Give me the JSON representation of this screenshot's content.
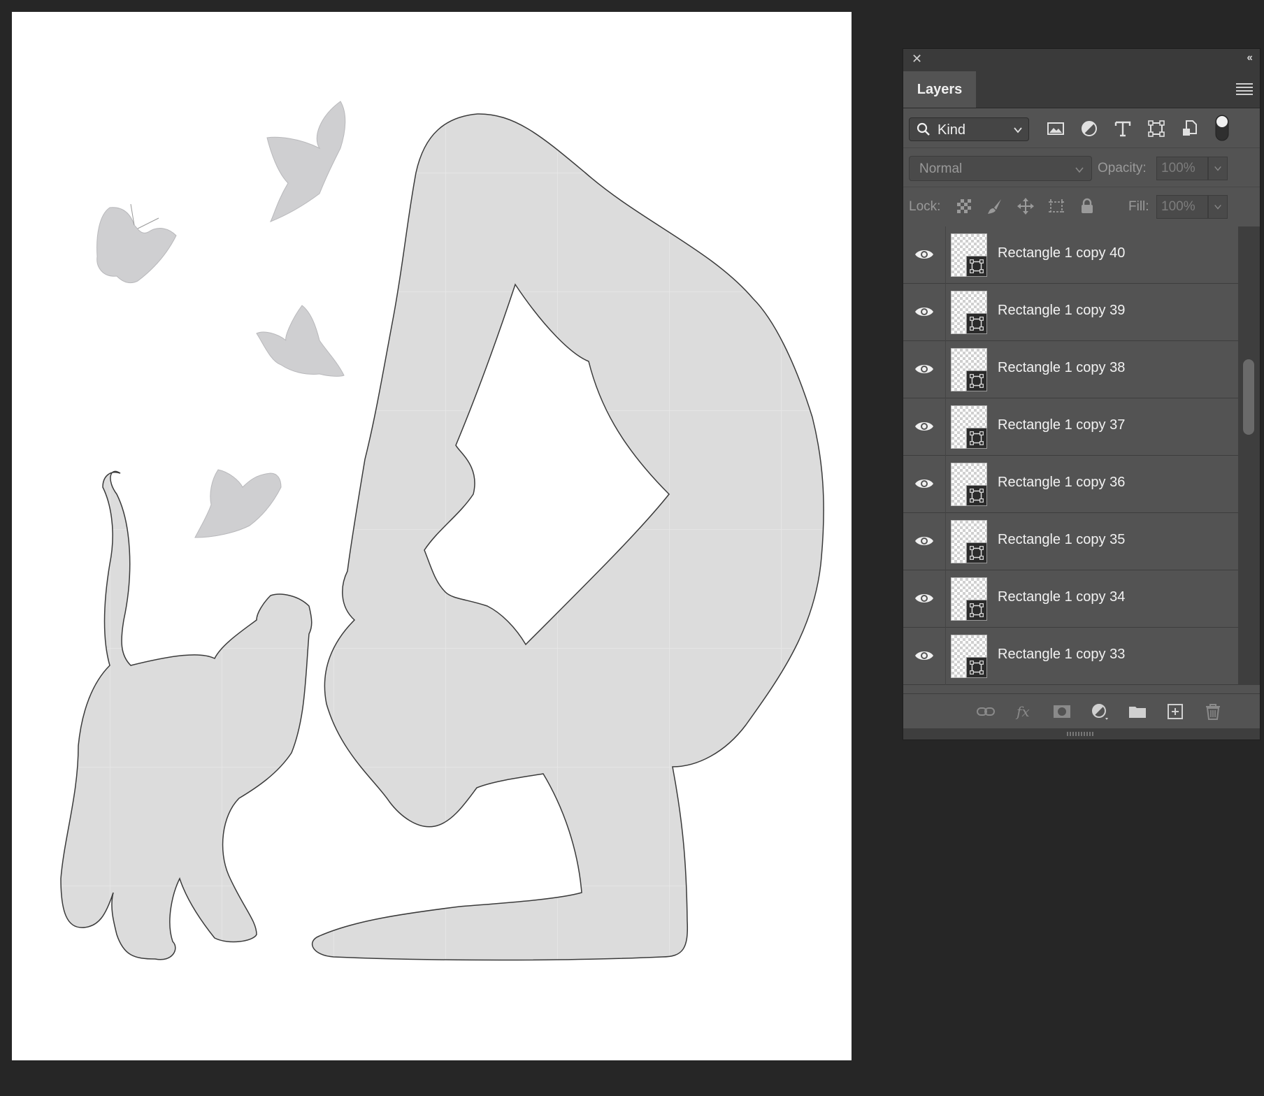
{
  "panel": {
    "title": "Layers",
    "filter": {
      "kind_label": "Kind",
      "icons": [
        "image-filter-icon",
        "adjustment-filter-icon",
        "type-filter-icon",
        "shape-filter-icon",
        "smart-object-filter-icon",
        "filter-toggle-icon"
      ]
    },
    "blend": {
      "mode": "Normal",
      "opacity_label": "Opacity:",
      "opacity_value": "100%"
    },
    "lock": {
      "label": "Lock:",
      "fill_label": "Fill:",
      "fill_value": "100%"
    },
    "layers": [
      {
        "name": "Rectangle 1 copy 40"
      },
      {
        "name": "Rectangle 1 copy 39"
      },
      {
        "name": "Rectangle 1 copy 38"
      },
      {
        "name": "Rectangle 1 copy 37"
      },
      {
        "name": "Rectangle 1 copy 36"
      },
      {
        "name": "Rectangle 1 copy 35"
      },
      {
        "name": "Rectangle 1 copy 34"
      },
      {
        "name": "Rectangle 1 copy 33"
      }
    ],
    "bottom_icons": [
      "link-layers-icon",
      "fx-icon",
      "add-mask-icon",
      "new-adjustment-icon",
      "new-group-icon",
      "new-layer-icon",
      "delete-layer-icon"
    ]
  },
  "colors": {
    "app_background": "#262626",
    "panel_background": "#535353",
    "canvas_background": "#ffffff",
    "silhouette_fill": "#dcdcdc",
    "butterfly_fill": "#cfcfd1"
  }
}
